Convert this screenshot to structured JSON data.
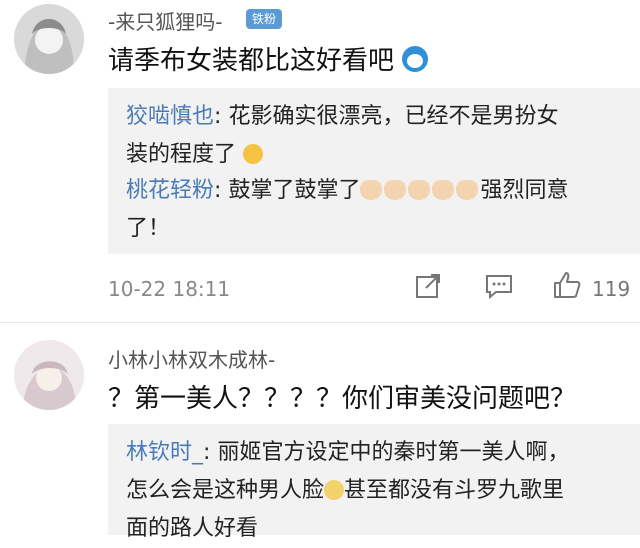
{
  "comments": [
    {
      "username": "-来只狐狸吗-",
      "badge": "铁粉",
      "text": "请季布女装都比这好看吧",
      "replies": [
        {
          "name": "狡啮慎也",
          "text_line1": "花影确实很漂亮，已经不是男扮女",
          "text_line2": "装的程度了"
        },
        {
          "name": "桃花轻粉",
          "text_line1": "鼓掌了鼓掌了",
          "text_after": "强烈同意",
          "text_line2": "了！"
        }
      ],
      "timestamp": "10-22 18:11",
      "likes": "119"
    },
    {
      "username": "小林小林双木成林-",
      "text": "？第一美人？？？？你们审美没问题吧？",
      "replies": [
        {
          "name": "林钦时_",
          "text_line1": "丽姬官方设定中的秦时第一美人啊，",
          "text_line2a": "怎么会是这种男人脸",
          "text_line2b": "甚至都没有斗罗九歌里",
          "text_line3": "面的路人好看"
        }
      ]
    }
  ],
  "icons": {
    "share": "share-icon",
    "comment": "comment-icon",
    "like": "thumbs-up-icon"
  },
  "colors": {
    "name_blue": "#4a7bb7",
    "badge": "#5b9bd5",
    "reply_bg": "#f2f2f2"
  }
}
